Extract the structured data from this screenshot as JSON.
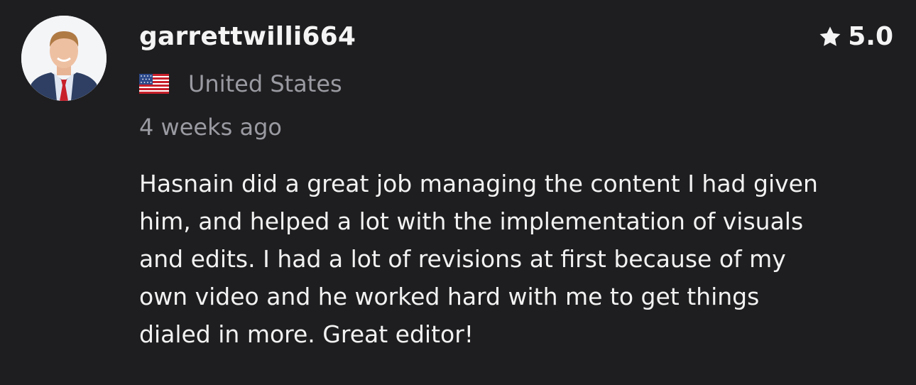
{
  "review": {
    "username": "garrettwilli664",
    "rating": "5.0",
    "country": "United States",
    "timestamp": "4 weeks ago",
    "text_lines": [
      "Hasnain did a great job managing the content I had given",
      "him, and helped a lot with the implementation of visuals",
      "and edits. I had a lot of revisions at first because of my",
      "own video and he worked hard with me to get things",
      "dialed in more. Great editor!"
    ]
  },
  "icons": {
    "rating": "star-icon",
    "country": "us-flag-icon"
  },
  "colors": {
    "background": "#1e1e20",
    "primary_text": "#f2f2f2",
    "secondary_text": "#9a9aa2"
  }
}
